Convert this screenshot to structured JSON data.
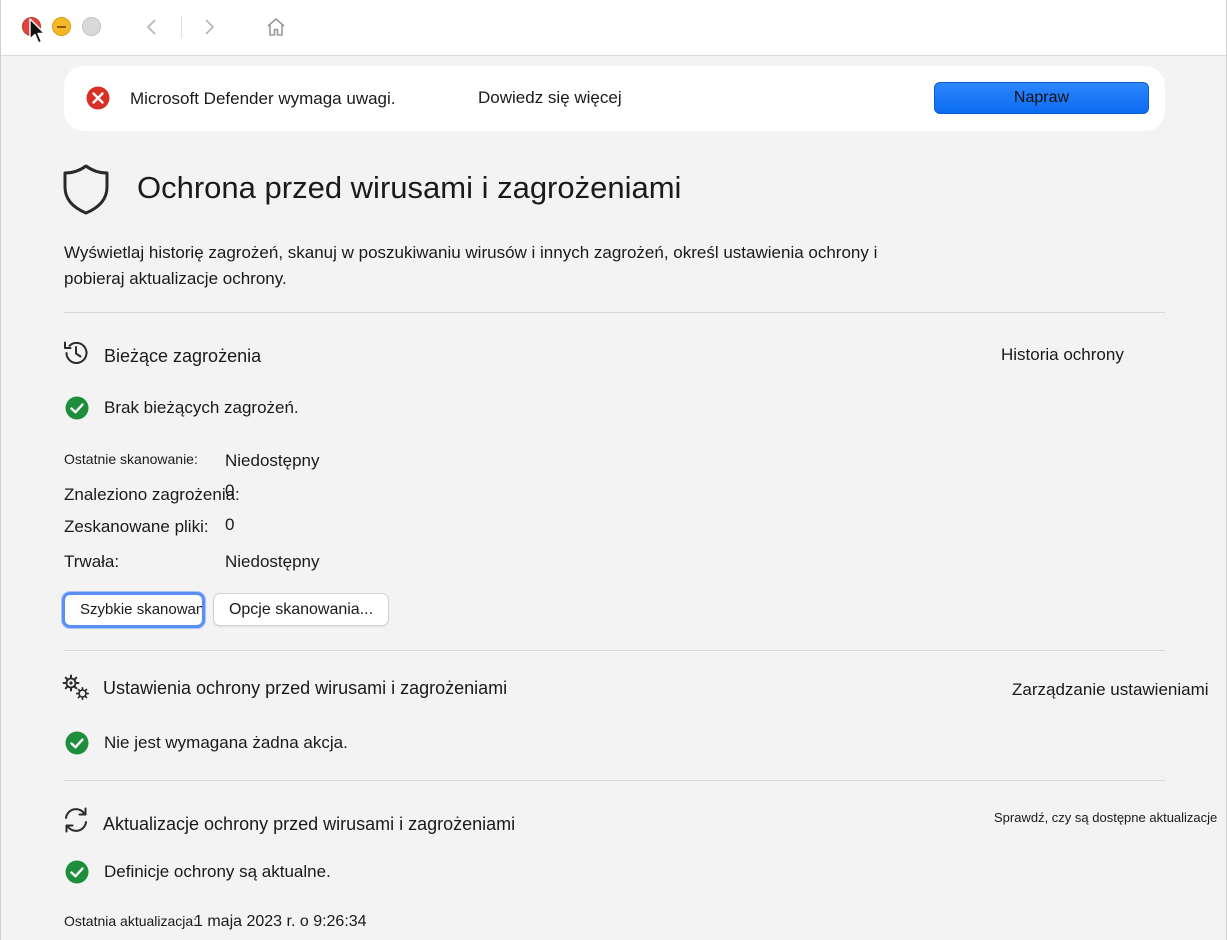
{
  "titlebar": {
    "icons": [
      "close-icon",
      "minimize-icon",
      "maximize-icon",
      "back-icon",
      "forward-icon",
      "home-icon"
    ]
  },
  "banner": {
    "message": "Microsoft Defender wymaga uwagi.",
    "learn_more": "Dowiedz się więcej",
    "fix_button": "Napraw",
    "icon": "error-icon"
  },
  "page": {
    "title": "Ochrona przed wirusami i zagrożeniami",
    "description_line1": "Wyświetlaj historię zagrożeń, skanuj w poszukiwaniu wirusów i innych zagrożeń, określ ustawienia ochrony i",
    "description_line2": "pobieraj aktualizacje ochrony."
  },
  "current_threats": {
    "title": "Bieżące zagrożenia",
    "link": "Historia ochrony",
    "status": "Brak bieżących zagrożeń.",
    "last_scan_label": "Ostatnie skanowanie:",
    "last_scan_value": "Niedostępny",
    "threats_found_label": "Znaleziono zagrożenia:",
    "threats_found_value": "0",
    "files_scanned_label": "Zeskanowane pliki:",
    "files_scanned_value": "0",
    "duration_label": "Trwała:",
    "duration_value": "Niedostępny",
    "quick_scan_button": "Szybkie skanowanie",
    "scan_options_button": "Opcje skanowania..."
  },
  "settings": {
    "title": "Ustawienia ochrony przed wirusami i zagrożeniami",
    "link": "Zarządzanie ustawieniami",
    "status": "Nie jest wymagana żadna akcja."
  },
  "updates": {
    "title": "Aktualizacje ochrony przed wirusami i zagrożeniami",
    "link": "Sprawdź, czy są dostępne aktualizacje",
    "status": "Definicje ochrony są aktualne.",
    "last_update_label": "Ostatnia aktualizacja:",
    "last_update_value": "1 maja 2023 r. o 9:26:34"
  },
  "colors": {
    "accent": "#1a73e8",
    "success": "#1e8e3e",
    "error": "#d93025"
  }
}
